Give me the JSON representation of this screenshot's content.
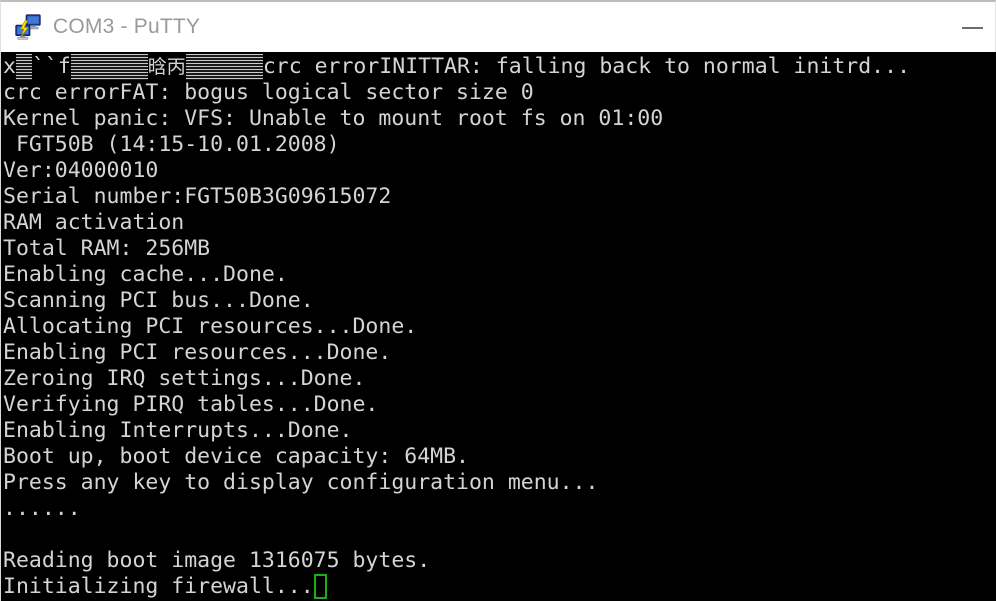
{
  "window": {
    "title": "COM3 - PuTTY",
    "icon": "putty-computers-icon",
    "minimize_label": "—",
    "titlebar_bg": "#ffffff",
    "title_color": "#9a9a9a"
  },
  "terminal": {
    "background": "#000000",
    "foreground": "#d4d4d4",
    "cursor_color": "#18b018",
    "cursor_style": "hollow-rectangle",
    "garbled_line": {
      "prefix": "x",
      "mid1": "``f",
      "cjk": "晗丙",
      "suffix": "crc errorINITTAR: falling back to normal initrd..."
    },
    "lines": [
      "crc errorFAT: bogus logical sector size 0",
      "Kernel panic: VFS: Unable to mount root fs on 01:00",
      " FGT50B (14:15-10.01.2008)",
      "Ver:04000010",
      "Serial number:FGT50B3G09615072",
      "RAM activation",
      "Total RAM: 256MB",
      "Enabling cache...Done.",
      "Scanning PCI bus...Done.",
      "Allocating PCI resources...Done.",
      "Enabling PCI resources...Done.",
      "Zeroing IRQ settings...Done.",
      "Verifying PIRQ tables...Done.",
      "Enabling Interrupts...Done.",
      "Boot up, boot device capacity: 64MB.",
      "Press any key to display configuration menu...",
      "......",
      "",
      "Reading boot image 1316075 bytes.",
      "Initializing firewall..."
    ],
    "last_line": "Initializing firewall..."
  }
}
